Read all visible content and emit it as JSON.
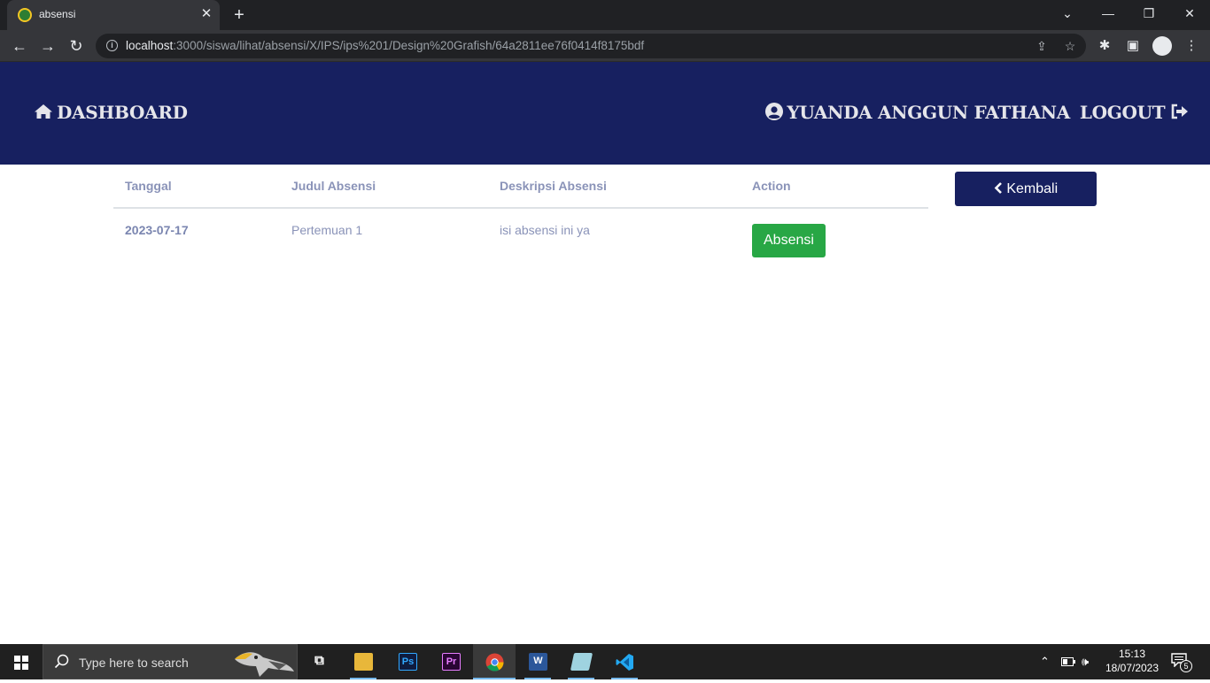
{
  "browser": {
    "tab_title": "absensi",
    "url_host": "localhost",
    "url_rest": ":3000/siswa/lihat/absensi/X/IPS/ips%201/Design%20Grafish/64a2811ee76f0414f8175bdf"
  },
  "header": {
    "brand": "DASHBOARD",
    "user_name": "YUANDA ANGGUN FATHANA",
    "logout": "LOGOUT"
  },
  "table": {
    "columns": [
      "Tanggal",
      "Judul Absensi",
      "Deskripsi Absensi",
      "Action"
    ],
    "rows": [
      {
        "tanggal": "2023-07-17",
        "judul": "Pertemuan 1",
        "deskripsi": "isi absensi ini ya",
        "action": "Absensi"
      }
    ]
  },
  "back_button": "Kembali",
  "taskbar": {
    "search_placeholder": "Type here to search",
    "time": "15:13",
    "date": "18/07/2023",
    "notification_count": "5"
  },
  "colors": {
    "header_bg": "#172060",
    "accent_green": "#28a745"
  }
}
